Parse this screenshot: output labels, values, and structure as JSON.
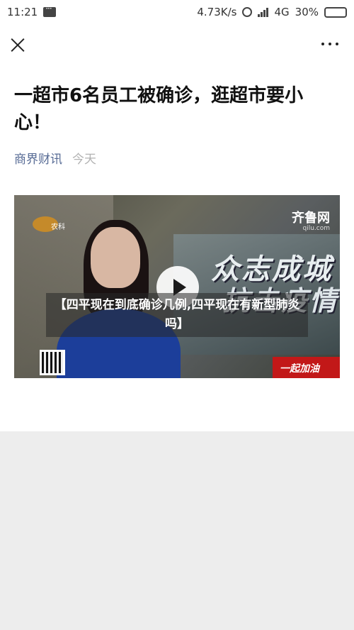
{
  "status_bar": {
    "time": "11:21",
    "speed": "4.73K/s",
    "network": "4G",
    "battery": "30%"
  },
  "nav": {
    "close_icon": "close-icon",
    "more_icon": "more-icon"
  },
  "article": {
    "title": "一超市6名员工被确诊，逛超市要小心！",
    "source": "商界财讯",
    "date": "今天"
  },
  "video": {
    "caption": "【四平现在到底确诊几例,四平现在有新型肺炎吗】",
    "overlay_text_1": "众志成城",
    "overlay_text_2": "抗击疫情",
    "logo_right": "齐鲁网",
    "logo_right_sub": "qilu.com",
    "logo_left": "农科",
    "bottom_banner": "一起加油"
  },
  "colors": {
    "source_link": "#576b95",
    "date": "#b2b2b2",
    "background": "#ededed"
  }
}
